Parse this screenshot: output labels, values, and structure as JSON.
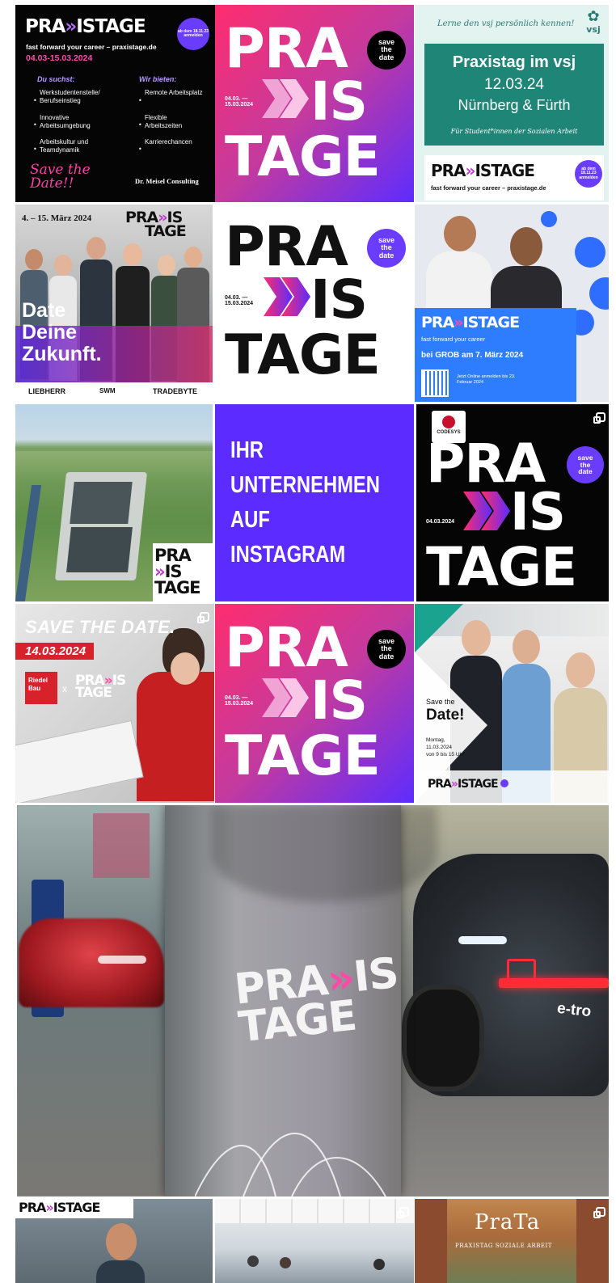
{
  "tiles": {
    "t1": {
      "title_pre": "PRA",
      "title_post": "ISTAGE",
      "badge": "ab dem 18.11.23 anmelden",
      "tagline": "fast forward your career – praxistage.de",
      "dates": "04.03-15.03.2024",
      "col1_head": "Du suchst:",
      "col1_items": [
        "Werkstudentenstelle/ Berufseinstieg",
        "Innovative Arbeitsumgebung",
        "Arbeitskultur und Teamdynamik"
      ],
      "col2_head": "Wir bieten:",
      "col2_items": [
        "Remote Arbeitsplatz",
        "Flexible Arbeitszeiten",
        "Karrierechancen"
      ],
      "script": "Save the Date!!",
      "company": "Dr. Meisel Consulting"
    },
    "t2": {
      "line1": "PRA",
      "line2": "IS",
      "line3": "TAGE",
      "dates": "04.03. — 15.03.2024",
      "badge": "save the date"
    },
    "t3": {
      "header": "Lerne den vsj persönlich kennen!",
      "logo": "vsj",
      "title": "Praxistag im vsj",
      "date": "12.03.24",
      "place": "Nürnberg & Fürth",
      "sub": "Für Student*innen der Sozialen Arbeit",
      "brand_pre": "PRA",
      "brand_post": "ISTAGE",
      "tagline": "fast forward your career – praxistage.de",
      "badge": "ab dem 18.11.23 anmelden"
    },
    "t4": {
      "date": "4. – 15. März 2024",
      "brand1": "PRA",
      "brand1b": "IS",
      "brand2": "TAGE",
      "slogan": [
        "Date",
        "Deine",
        "Zukunft."
      ],
      "logos": [
        "LIEBHERR",
        "SWM",
        "TRADEBYTE"
      ]
    },
    "t5": {
      "line1": "PRA",
      "line2": "IS",
      "line3": "TAGE",
      "dates": "04.03. — 15.03.2024",
      "badge": "save the date"
    },
    "t6": {
      "brand_pre": "PRA",
      "brand_post": "ISTAGE",
      "tagline": "fast forward your career",
      "event": "bei GROB am 7. März 2024",
      "note": "Jetzt Online anmelden bis 23. Februar 2024"
    },
    "t7": {
      "brand1": "PRA",
      "brand2": "IS",
      "brand3": "TAGE"
    },
    "t8": {
      "lines": [
        "IHR",
        "UNTERNEHMEN",
        "AUF",
        "INSTAGRAM"
      ]
    },
    "t9": {
      "logo": "CODESYS",
      "line1": "PRA",
      "line2": "IS",
      "line3": "TAGE",
      "date": "04.03.2024",
      "badge": "save the date"
    },
    "t10": {
      "headline": "SAVE THE DATE.",
      "date": "14.03.2024",
      "logo": "Riedel Bau",
      "x": "x",
      "brand1": "PRA",
      "brand1b": "IS",
      "brand2": "TAGE"
    },
    "t11": {
      "line1": "PRA",
      "line2": "IS",
      "line3": "TAGE",
      "dates": "04.03. — 15.03.2024",
      "badge": "save the date"
    },
    "t12": {
      "save": "Save the",
      "date_big": "Date!",
      "details": [
        "Montag,",
        "11.03.2024",
        "von 9 bis 15 Uhr"
      ],
      "brand_pre": "PRA",
      "brand_post": "ISTAGE"
    },
    "big": {
      "brand1": "PRA",
      "brand1b": "IS",
      "brand2": "TAGE",
      "plate": "e-tro"
    },
    "b1": {
      "brand_pre": "PRA",
      "brand_post": "ISTAGE"
    },
    "b3": {
      "title": "PraTa",
      "sub": "PRAXISTAG SOZIALE ARBEIT"
    }
  },
  "colors": {
    "purple": "#5b2bff",
    "pink": "#ff2d6e",
    "violet": "#9a3ad9",
    "teal": "#2d8a80",
    "blue": "#2f7dff",
    "black": "#0a0a0a"
  }
}
